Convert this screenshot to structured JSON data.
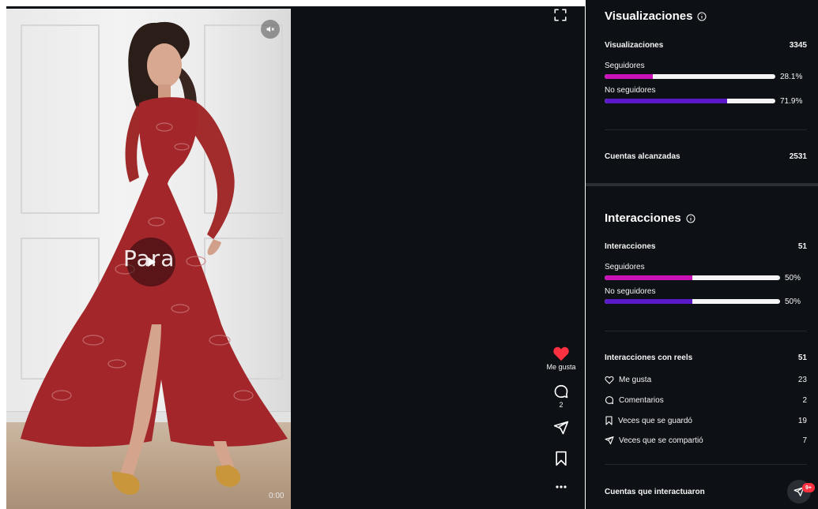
{
  "video": {
    "overlay_text": "Para",
    "timecode": "0:00",
    "mute_icon": "volume-muted-icon",
    "play_icon": "play-icon"
  },
  "rail": {
    "like_label": "Me gusta",
    "comment_count": "2",
    "icons": [
      "expand-icon",
      "heart-icon",
      "comment-icon",
      "share-icon",
      "bookmark-icon",
      "more-icon"
    ]
  },
  "colors": {
    "panel_bg": "#0d1014",
    "followers_bar": "#c913b9",
    "non_followers_bar": "#5a19c9",
    "like_red": "#ff3040"
  },
  "views": {
    "title": "Visualizaciones",
    "total_label": "Visualizaciones",
    "total_value": "3345",
    "followers_label": "Seguidores",
    "followers_pct": "28.1%",
    "followers_fraction": 0.281,
    "non_followers_label": "No seguidores",
    "non_followers_pct": "71.9%",
    "non_followers_fraction": 0.719,
    "reach_label": "Cuentas alcanzadas",
    "reach_value": "2531"
  },
  "interactions": {
    "title": "Interacciones",
    "total_label": "Interacciones",
    "total_value": "51",
    "followers_label": "Seguidores",
    "followers_pct": "50%",
    "followers_fraction": 0.5,
    "non_followers_label": "No seguidores",
    "non_followers_pct": "50%",
    "non_followers_fraction": 0.5,
    "reels_label": "Interacciones con reels",
    "reels_value": "51",
    "items": [
      {
        "label": "Me gusta",
        "value": "23",
        "icon": "heart-outline-icon"
      },
      {
        "label": "Comentarios",
        "value": "2",
        "icon": "comment-icon"
      },
      {
        "label": "Veces que se guardó",
        "value": "19",
        "icon": "bookmark-icon"
      },
      {
        "label": "Veces que se compartió",
        "value": "7",
        "icon": "share-icon"
      }
    ],
    "accounts_label": "Cuentas que interactuaron"
  },
  "messages": {
    "badge": "9+",
    "icon": "direct-message-icon"
  }
}
